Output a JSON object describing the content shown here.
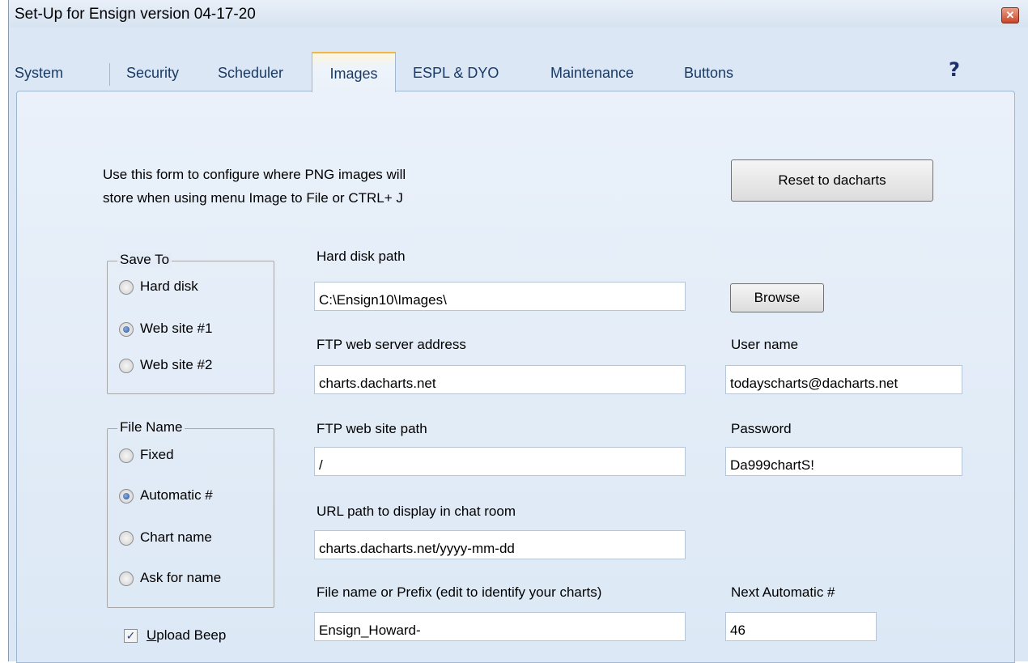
{
  "window": {
    "title": "Set-Up for Ensign version 04-17-20",
    "close_glyph": "✕"
  },
  "tabs": [
    {
      "label": "System"
    },
    {
      "label": "Security"
    },
    {
      "label": "Scheduler"
    },
    {
      "label": "Images",
      "active": true
    },
    {
      "label": "ESPL & DYO"
    },
    {
      "label": "Maintenance"
    },
    {
      "label": "Buttons"
    }
  ],
  "help_glyph": "?",
  "instructions": {
    "line1": "Use this form to configure where PNG images will",
    "line2": "store when using menu Image to File or CTRL+ J"
  },
  "reset_button": "Reset to dacharts",
  "save_to": {
    "title": "Save To",
    "options": [
      {
        "label": "Hard disk",
        "checked": false
      },
      {
        "label": "Web site #1",
        "checked": true
      },
      {
        "label": "Web site #2",
        "checked": false
      }
    ]
  },
  "file_name": {
    "title": "File Name",
    "options": [
      {
        "label": "Fixed",
        "checked": false
      },
      {
        "label": "Automatic #",
        "checked": true
      },
      {
        "label": "Chart name",
        "checked": false
      },
      {
        "label": "Ask for name",
        "checked": false
      }
    ]
  },
  "fields": {
    "hard_disk_path": {
      "label": "Hard disk path",
      "value": "C:\\Ensign10\\Images\\"
    },
    "browse_button": "Browse",
    "ftp_server": {
      "label": "FTP web server address",
      "value": "charts.dacharts.net"
    },
    "user_name": {
      "label": "User name",
      "value": "todayscharts@dacharts.net"
    },
    "ftp_path": {
      "label": "FTP web site path",
      "value": "/"
    },
    "password": {
      "label": "Password",
      "value": "Da999chartS!"
    },
    "url_path": {
      "label": "URL path to display in chat room",
      "value": "charts.dacharts.net/yyyy-mm-dd"
    },
    "file_prefix": {
      "label": "File name or Prefix  (edit to identify your charts)",
      "value": "Ensign_Howard-"
    },
    "next_auto": {
      "label": "Next Automatic #",
      "value": "46"
    }
  },
  "upload_beep": {
    "label_rest": "pload Beep",
    "label_underlined": "U",
    "checked": true,
    "check_glyph": "✓"
  }
}
